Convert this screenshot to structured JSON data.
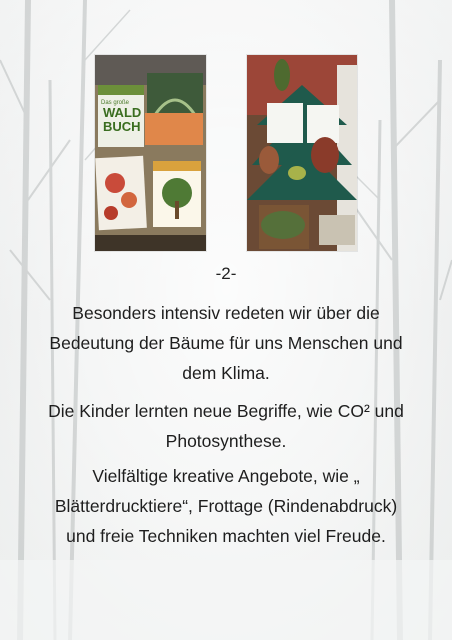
{
  "page": {
    "number": "-2-",
    "paragraphs": [
      "Besonders intensiv redeten wir über die Bedeutung der Bäume für uns Menschen und dem Klima.",
      "Die Kinder lernten neue Begriffe, wie CO² und Photosynthese.",
      "Vielfältige kreative Angebote, wie „ Blätterdrucktiere“, Frottage (Rindenabdruck) und freie Techniken machten viel Freude."
    ]
  },
  "photos": {
    "left": {
      "book_title_line1": "Das große",
      "book_title_line2": "WALD",
      "book_title_line3": "BUCH"
    }
  },
  "colors": {
    "text": "#1e1e1e",
    "tree_green": "#1f5a4c",
    "book_green": "#3e5a3a",
    "orange_card": "#e0874a"
  }
}
